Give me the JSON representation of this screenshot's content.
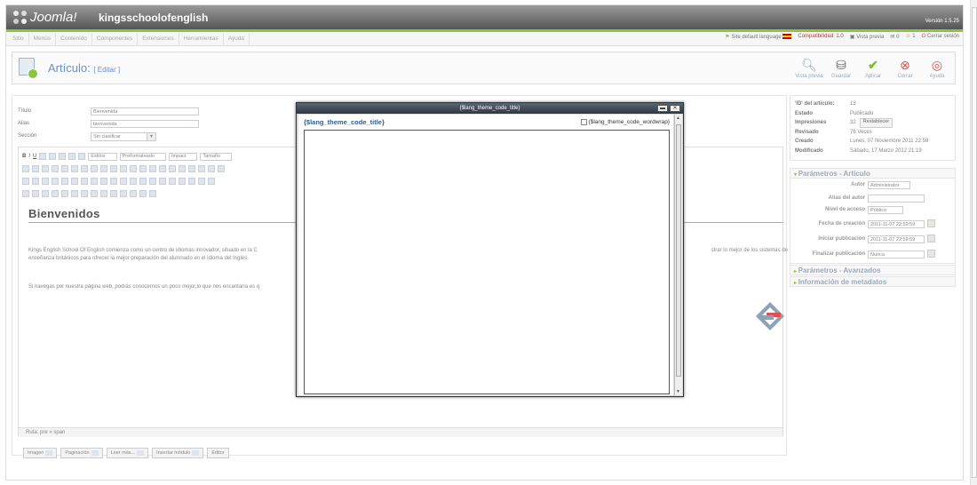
{
  "header": {
    "logo_text": "Joomla!",
    "site_name": "kingsschoolofenglish",
    "version": "Versión 1.5.25"
  },
  "menu": [
    "Sitio",
    "Menús",
    "Contenido",
    "Componentes",
    "Extensiones",
    "Herramientas",
    "Ayuda"
  ],
  "status": {
    "site_language": "Site default language",
    "compat": "Compatibilidad: 1.0",
    "preview": "Vista previa",
    "messages": "0",
    "users": "1",
    "logout": "Cerrar sesión"
  },
  "page": {
    "title": "Artículo:",
    "subtitle": "[ Editar ]"
  },
  "toolbar": [
    {
      "label": "Vista previa",
      "icon": "magnifier-icon"
    },
    {
      "label": "Guardar",
      "icon": "save-icon"
    },
    {
      "label": "Aplicar",
      "icon": "check-icon"
    },
    {
      "label": "Cerrar",
      "icon": "close-icon"
    },
    {
      "label": "Ayuda",
      "icon": "help-icon"
    }
  ],
  "form": {
    "titulo_label": "Título",
    "titulo_value": "Bienvenida",
    "alias_label": "Alias",
    "alias_value": "bienvenida",
    "seccion_label": "Sección",
    "seccion_value": "Sin clasificar"
  },
  "editor": {
    "estilos": "Estilos",
    "preformat": "Preformateado",
    "font": "Impact",
    "size": "Tamaño",
    "heading": "Bienvenidos",
    "para1a": "Kings English School Of English comienza como un centro de idiomas innovador, situado en la C",
    "para1b": "strar lo mejor de los sistemas de",
    "para1c": "enseñanza británicos para ofrecer la mejor preparación del alumnado en el idioma del Inglés.",
    "para2": "Si navegas por nuestra página web, podrás conocernos un poco mejor,lo que nos encantaría es q",
    "ruta": "Ruta: pre » span"
  },
  "editor_buttons": [
    "Imagen",
    "Paginación",
    "Leer más...",
    "Insertar módulo",
    "Editor"
  ],
  "info": [
    {
      "k": "'ID' del artículo:",
      "v": "13"
    },
    {
      "k": "Estado",
      "v": "Publicado"
    },
    {
      "k": "Impresiones",
      "v": "32",
      "button": "Restablecer"
    },
    {
      "k": "Revisado",
      "v": "76 Veces"
    },
    {
      "k": "Creado",
      "v": "Lunes, 07 Noviembre 2011 22:59"
    },
    {
      "k": "Modificado",
      "v": "Sábado, 17 Marzo 2012 21:19"
    }
  ],
  "params": {
    "header": "Parámetros - Artículo",
    "autor_label": "Autor",
    "autor_value": "Administrator",
    "alias_autor_label": "Alias del autor",
    "acceso_label": "Nivel de acceso",
    "acceso_value": "Público",
    "fecha_label": "Fecha de creación",
    "fecha_value": "2011-11-07 22:59:59",
    "iniciar_label": "Iniciar publicación",
    "iniciar_value": "2011-11-07 22:59:59",
    "finalizar_label": "Finalizar publicación",
    "finalizar_value": "Nunca"
  },
  "panels": [
    "Parámetros - Avanzados",
    "Información de metadatos"
  ],
  "modal": {
    "window_title": "{$lang_theme_code_title}",
    "heading": "{$lang_theme_code_title}",
    "wordwrap": "{$lang_theme_code_wordwrap}"
  }
}
